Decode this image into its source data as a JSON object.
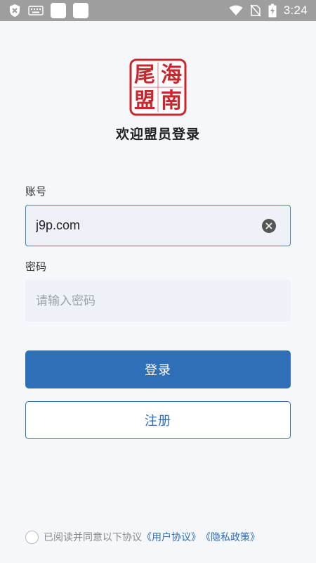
{
  "status_bar": {
    "time": "3:24",
    "icons": [
      "shield-icon",
      "keyboard-icon",
      "notification-icon",
      "notification-icon",
      "wifi-icon",
      "no-sim-icon",
      "battery-charging-icon"
    ]
  },
  "header": {
    "logo_name": "seal-logo",
    "logo_chars": [
      "海",
      "南",
      "尾",
      "盟"
    ],
    "welcome": "欢迎盟员登录"
  },
  "form": {
    "account_label": "账号",
    "account_value": "j9p.com",
    "password_label": "密码",
    "password_placeholder": "请输入密码"
  },
  "buttons": {
    "login": "登录",
    "register": "注册"
  },
  "agreement": {
    "text": "已阅读并同意以下协议",
    "link1": "《用户协议》",
    "link2": "《隐私政策》",
    "checked": false
  },
  "colors": {
    "primary": "#2e6fb8",
    "seal_red": "#c8272d",
    "background": "#f5f7fa",
    "status_bar": "#9e9e9e"
  }
}
